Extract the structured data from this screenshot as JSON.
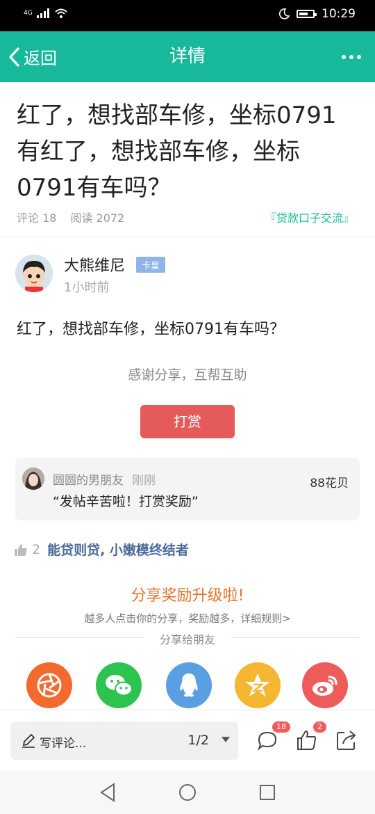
{
  "status": {
    "network": "4G",
    "time": "10:29"
  },
  "nav": {
    "back_label": "返回",
    "title": "详情"
  },
  "post": {
    "title": "红了，想找部车修，坐标0791有红了，想找部车修，坐标0791有车吗？",
    "comments_label": "评论 18",
    "reads_label": "阅读 2072",
    "category": "『贷款口子交流』",
    "author": "大熊维尼",
    "author_badge": "卡皇",
    "time_ago": "1小时前",
    "body": "红了，想找部车修，坐标0791有车吗？"
  },
  "reward": {
    "thanks_text": "感谢分享，互帮互助",
    "button_label": "打赏",
    "record": {
      "name": "圆圆的男朋友",
      "time": "刚刚",
      "amount": "88花贝",
      "message": "“发帖辛苦啦！打赏奖励”"
    }
  },
  "likes": {
    "count": "2",
    "names": "能贷则贷, 小嫩模终结者"
  },
  "share": {
    "headline": "分享奖励升级啦!",
    "subtext": "越多人点击你的分享，奖励越多，详细规则>",
    "divider_label": "分享给朋友",
    "targets": [
      {
        "icon": "moments-icon",
        "color": "#f26a2e"
      },
      {
        "icon": "wechat-icon",
        "color": "#2dc34f"
      },
      {
        "icon": "qq-icon",
        "color": "#5b9fe3"
      },
      {
        "icon": "qzone-icon",
        "color": "#f5b731"
      },
      {
        "icon": "weibo-icon",
        "color": "#ee5b5b"
      }
    ]
  },
  "bottom": {
    "comment_placeholder": "写评论...",
    "page_indicator": "1/2",
    "comments_badge": "18",
    "likes_badge": "2"
  },
  "colors": {
    "accent": "#18b99b",
    "reward": "#e55a5a",
    "share_headline": "#e8732a",
    "badge": "#f25b5b"
  }
}
